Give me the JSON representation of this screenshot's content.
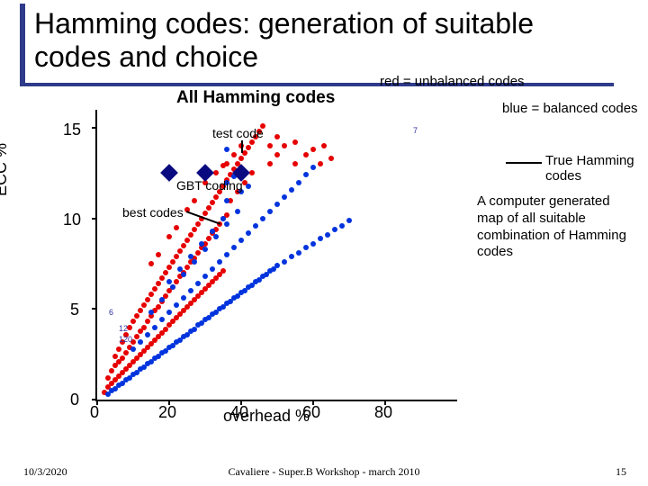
{
  "title": "Hamming codes: generation of suitable codes and choice",
  "legend": {
    "red": "red = unbalanced codes",
    "blue": "blue = balanced codes",
    "true_hamming": "True Hamming\ncodes"
  },
  "caption": "A computer generated map of all suitable combination of Hamming codes",
  "annotations": {
    "test_code": "test code",
    "gbt_coding": "GBT coding",
    "best_codes": "best codes",
    "num_right_small": "7",
    "num_left_small1": "6",
    "num_left_small2": "12",
    "num_left_small3": "120"
  },
  "footer": {
    "date": "10/3/2020",
    "center": "Cavaliere - Super.B Workshop - march 2010",
    "page": "15"
  },
  "chart_data": {
    "type": "scatter",
    "title": "All Hamming codes",
    "xlabel": "overhead %",
    "ylabel": "ECC %",
    "xlim": [
      0,
      100
    ],
    "ylim": [
      0,
      16
    ],
    "xticks": [
      0,
      20,
      40,
      60,
      80
    ],
    "yticks": [
      0,
      5,
      10,
      15
    ],
    "diamonds": [
      {
        "x": 20,
        "y": 12.5
      },
      {
        "x": 30,
        "y": 12.5
      },
      {
        "x": 40,
        "y": 12.5
      }
    ],
    "series": [
      {
        "name": "unbalanced",
        "color": "red",
        "points": [
          {
            "x": 2,
            "y": 0.4
          },
          {
            "x": 3,
            "y": 0.7
          },
          {
            "x": 3,
            "y": 1.2
          },
          {
            "x": 4,
            "y": 0.9
          },
          {
            "x": 4,
            "y": 1.6
          },
          {
            "x": 5,
            "y": 1.1
          },
          {
            "x": 5,
            "y": 1.9
          },
          {
            "x": 5,
            "y": 2.4
          },
          {
            "x": 6,
            "y": 1.3
          },
          {
            "x": 6,
            "y": 2.1
          },
          {
            "x": 6,
            "y": 2.8
          },
          {
            "x": 7,
            "y": 1.5
          },
          {
            "x": 7,
            "y": 2.3
          },
          {
            "x": 7,
            "y": 3.2
          },
          {
            "x": 8,
            "y": 1.7
          },
          {
            "x": 8,
            "y": 2.6
          },
          {
            "x": 8,
            "y": 3.6
          },
          {
            "x": 9,
            "y": 1.9
          },
          {
            "x": 9,
            "y": 2.9
          },
          {
            "x": 9,
            "y": 4.0
          },
          {
            "x": 10,
            "y": 2.1
          },
          {
            "x": 10,
            "y": 3.2
          },
          {
            "x": 10,
            "y": 4.3
          },
          {
            "x": 11,
            "y": 2.3
          },
          {
            "x": 11,
            "y": 3.5
          },
          {
            "x": 11,
            "y": 4.6
          },
          {
            "x": 12,
            "y": 2.5
          },
          {
            "x": 12,
            "y": 3.8
          },
          {
            "x": 12,
            "y": 4.9
          },
          {
            "x": 13,
            "y": 2.7
          },
          {
            "x": 13,
            "y": 4.0
          },
          {
            "x": 13,
            "y": 5.2
          },
          {
            "x": 14,
            "y": 2.9
          },
          {
            "x": 14,
            "y": 4.3
          },
          {
            "x": 14,
            "y": 5.5
          },
          {
            "x": 15,
            "y": 3.1
          },
          {
            "x": 15,
            "y": 4.6
          },
          {
            "x": 15,
            "y": 5.8
          },
          {
            "x": 16,
            "y": 3.3
          },
          {
            "x": 16,
            "y": 4.9
          },
          {
            "x": 16,
            "y": 6.1
          },
          {
            "x": 17,
            "y": 3.5
          },
          {
            "x": 17,
            "y": 5.1
          },
          {
            "x": 17,
            "y": 6.4
          },
          {
            "x": 18,
            "y": 3.7
          },
          {
            "x": 18,
            "y": 5.4
          },
          {
            "x": 18,
            "y": 6.7
          },
          {
            "x": 19,
            "y": 3.9
          },
          {
            "x": 19,
            "y": 5.7
          },
          {
            "x": 19,
            "y": 7.0
          },
          {
            "x": 20,
            "y": 4.1
          },
          {
            "x": 20,
            "y": 6.0
          },
          {
            "x": 20,
            "y": 7.3
          },
          {
            "x": 21,
            "y": 4.3
          },
          {
            "x": 21,
            "y": 6.2
          },
          {
            "x": 21,
            "y": 7.6
          },
          {
            "x": 22,
            "y": 4.5
          },
          {
            "x": 22,
            "y": 6.5
          },
          {
            "x": 22,
            "y": 7.9
          },
          {
            "x": 23,
            "y": 4.7
          },
          {
            "x": 23,
            "y": 6.8
          },
          {
            "x": 23,
            "y": 8.2
          },
          {
            "x": 24,
            "y": 4.9
          },
          {
            "x": 24,
            "y": 7.0
          },
          {
            "x": 24,
            "y": 8.5
          },
          {
            "x": 25,
            "y": 5.1
          },
          {
            "x": 25,
            "y": 7.3
          },
          {
            "x": 25,
            "y": 8.8
          },
          {
            "x": 26,
            "y": 5.3
          },
          {
            "x": 26,
            "y": 7.6
          },
          {
            "x": 26,
            "y": 9.1
          },
          {
            "x": 27,
            "y": 5.5
          },
          {
            "x": 27,
            "y": 7.8
          },
          {
            "x": 27,
            "y": 9.4
          },
          {
            "x": 28,
            "y": 5.7
          },
          {
            "x": 28,
            "y": 8.1
          },
          {
            "x": 28,
            "y": 9.7
          },
          {
            "x": 29,
            "y": 5.9
          },
          {
            "x": 29,
            "y": 8.4
          },
          {
            "x": 29,
            "y": 10.0
          },
          {
            "x": 30,
            "y": 6.1
          },
          {
            "x": 30,
            "y": 8.6
          },
          {
            "x": 30,
            "y": 10.3
          },
          {
            "x": 31,
            "y": 6.3
          },
          {
            "x": 31,
            "y": 8.9
          },
          {
            "x": 31,
            "y": 10.6
          },
          {
            "x": 32,
            "y": 6.5
          },
          {
            "x": 32,
            "y": 9.2
          },
          {
            "x": 32,
            "y": 10.9
          },
          {
            "x": 33,
            "y": 6.7
          },
          {
            "x": 33,
            "y": 9.4
          },
          {
            "x": 33,
            "y": 11.2
          },
          {
            "x": 34,
            "y": 6.9
          },
          {
            "x": 34,
            "y": 9.7
          },
          {
            "x": 34,
            "y": 11.5
          },
          {
            "x": 35,
            "y": 7.1
          },
          {
            "x": 35,
            "y": 10.0
          },
          {
            "x": 35,
            "y": 11.8
          },
          {
            "x": 36,
            "y": 10.2
          },
          {
            "x": 36,
            "y": 12.1
          },
          {
            "x": 36,
            "y": 13.0
          },
          {
            "x": 37,
            "y": 12.4
          },
          {
            "x": 38,
            "y": 12.7
          },
          {
            "x": 38,
            "y": 13.5
          },
          {
            "x": 39,
            "y": 13.0
          },
          {
            "x": 40,
            "y": 13.3
          },
          {
            "x": 40,
            "y": 14.0
          },
          {
            "x": 41,
            "y": 13.6
          },
          {
            "x": 42,
            "y": 13.9
          },
          {
            "x": 43,
            "y": 14.2
          },
          {
            "x": 44,
            "y": 14.5
          },
          {
            "x": 45,
            "y": 14.8
          },
          {
            "x": 46,
            "y": 15.1
          },
          {
            "x": 48,
            "y": 13.0
          },
          {
            "x": 48,
            "y": 14.0
          },
          {
            "x": 50,
            "y": 13.5
          },
          {
            "x": 50,
            "y": 14.5
          },
          {
            "x": 52,
            "y": 14.0
          },
          {
            "x": 55,
            "y": 13.0
          },
          {
            "x": 55,
            "y": 14.2
          },
          {
            "x": 58,
            "y": 13.5
          },
          {
            "x": 60,
            "y": 13.8
          },
          {
            "x": 62,
            "y": 13.0
          },
          {
            "x": 63,
            "y": 14.0
          },
          {
            "x": 65,
            "y": 13.3
          },
          {
            "x": 20,
            "y": 9.0
          },
          {
            "x": 22,
            "y": 9.5
          },
          {
            "x": 25,
            "y": 10.5
          },
          {
            "x": 27,
            "y": 11.0
          },
          {
            "x": 30,
            "y": 12.0
          },
          {
            "x": 15,
            "y": 7.5
          },
          {
            "x": 17,
            "y": 8.0
          },
          {
            "x": 33,
            "y": 12.5
          },
          {
            "x": 35,
            "y": 12.9
          },
          {
            "x": 37,
            "y": 11.0
          },
          {
            "x": 39,
            "y": 11.5
          },
          {
            "x": 41,
            "y": 12.0
          },
          {
            "x": 43,
            "y": 12.5
          }
        ]
      },
      {
        "name": "balanced",
        "color": "blue",
        "points": [
          {
            "x": 3,
            "y": 0.3
          },
          {
            "x": 4,
            "y": 0.5
          },
          {
            "x": 5,
            "y": 0.6
          },
          {
            "x": 6,
            "y": 0.8
          },
          {
            "x": 7,
            "y": 0.9
          },
          {
            "x": 8,
            "y": 1.1
          },
          {
            "x": 9,
            "y": 1.2
          },
          {
            "x": 10,
            "y": 1.4
          },
          {
            "x": 11,
            "y": 1.5
          },
          {
            "x": 12,
            "y": 1.7
          },
          {
            "x": 13,
            "y": 1.8
          },
          {
            "x": 14,
            "y": 2.0
          },
          {
            "x": 15,
            "y": 2.1
          },
          {
            "x": 16,
            "y": 2.3
          },
          {
            "x": 17,
            "y": 2.4
          },
          {
            "x": 18,
            "y": 2.6
          },
          {
            "x": 19,
            "y": 2.7
          },
          {
            "x": 20,
            "y": 2.9
          },
          {
            "x": 21,
            "y": 3.0
          },
          {
            "x": 22,
            "y": 3.2
          },
          {
            "x": 23,
            "y": 3.3
          },
          {
            "x": 24,
            "y": 3.5
          },
          {
            "x": 25,
            "y": 3.6
          },
          {
            "x": 26,
            "y": 3.8
          },
          {
            "x": 27,
            "y": 3.9
          },
          {
            "x": 28,
            "y": 4.1
          },
          {
            "x": 29,
            "y": 4.2
          },
          {
            "x": 30,
            "y": 4.4
          },
          {
            "x": 31,
            "y": 4.5
          },
          {
            "x": 32,
            "y": 4.7
          },
          {
            "x": 33,
            "y": 4.8
          },
          {
            "x": 34,
            "y": 5.0
          },
          {
            "x": 35,
            "y": 5.1
          },
          {
            "x": 36,
            "y": 5.3
          },
          {
            "x": 37,
            "y": 5.4
          },
          {
            "x": 38,
            "y": 5.6
          },
          {
            "x": 39,
            "y": 5.7
          },
          {
            "x": 40,
            "y": 5.9
          },
          {
            "x": 41,
            "y": 6.0
          },
          {
            "x": 42,
            "y": 6.2
          },
          {
            "x": 43,
            "y": 6.3
          },
          {
            "x": 44,
            "y": 6.5
          },
          {
            "x": 45,
            "y": 6.6
          },
          {
            "x": 46,
            "y": 6.8
          },
          {
            "x": 47,
            "y": 6.9
          },
          {
            "x": 48,
            "y": 7.1
          },
          {
            "x": 49,
            "y": 7.2
          },
          {
            "x": 50,
            "y": 7.4
          },
          {
            "x": 52,
            "y": 7.6
          },
          {
            "x": 54,
            "y": 7.9
          },
          {
            "x": 56,
            "y": 8.1
          },
          {
            "x": 58,
            "y": 8.4
          },
          {
            "x": 60,
            "y": 8.6
          },
          {
            "x": 62,
            "y": 8.9
          },
          {
            "x": 64,
            "y": 9.1
          },
          {
            "x": 66,
            "y": 9.4
          },
          {
            "x": 68,
            "y": 9.6
          },
          {
            "x": 70,
            "y": 9.9
          },
          {
            "x": 10,
            "y": 2.8
          },
          {
            "x": 12,
            "y": 3.2
          },
          {
            "x": 14,
            "y": 3.6
          },
          {
            "x": 16,
            "y": 4.0
          },
          {
            "x": 18,
            "y": 4.4
          },
          {
            "x": 20,
            "y": 4.8
          },
          {
            "x": 22,
            "y": 5.2
          },
          {
            "x": 24,
            "y": 5.6
          },
          {
            "x": 26,
            "y": 6.0
          },
          {
            "x": 28,
            "y": 6.4
          },
          {
            "x": 30,
            "y": 6.8
          },
          {
            "x": 32,
            "y": 7.2
          },
          {
            "x": 34,
            "y": 7.6
          },
          {
            "x": 36,
            "y": 8.0
          },
          {
            "x": 38,
            "y": 8.4
          },
          {
            "x": 40,
            "y": 8.8
          },
          {
            "x": 42,
            "y": 9.2
          },
          {
            "x": 44,
            "y": 9.6
          },
          {
            "x": 46,
            "y": 10.0
          },
          {
            "x": 48,
            "y": 10.4
          },
          {
            "x": 50,
            "y": 10.8
          },
          {
            "x": 52,
            "y": 11.2
          },
          {
            "x": 54,
            "y": 11.6
          },
          {
            "x": 56,
            "y": 12.0
          },
          {
            "x": 58,
            "y": 12.4
          },
          {
            "x": 60,
            "y": 12.8
          },
          {
            "x": 15,
            "y": 4.8
          },
          {
            "x": 18,
            "y": 5.5
          },
          {
            "x": 21,
            "y": 6.2
          },
          {
            "x": 24,
            "y": 6.9
          },
          {
            "x": 27,
            "y": 7.6
          },
          {
            "x": 30,
            "y": 8.3
          },
          {
            "x": 33,
            "y": 9.0
          },
          {
            "x": 36,
            "y": 9.7
          },
          {
            "x": 39,
            "y": 10.4
          },
          {
            "x": 36,
            "y": 12.0
          },
          {
            "x": 38,
            "y": 12.3
          },
          {
            "x": 40,
            "y": 11.5
          },
          {
            "x": 42,
            "y": 11.8
          },
          {
            "x": 20,
            "y": 6.5
          },
          {
            "x": 23,
            "y": 7.2
          },
          {
            "x": 26,
            "y": 7.9
          },
          {
            "x": 29,
            "y": 8.6
          },
          {
            "x": 32,
            "y": 9.3
          },
          {
            "x": 35,
            "y": 10.0
          },
          {
            "x": 36,
            "y": 11.0
          },
          {
            "x": 36,
            "y": 13.8
          }
        ]
      }
    ]
  }
}
